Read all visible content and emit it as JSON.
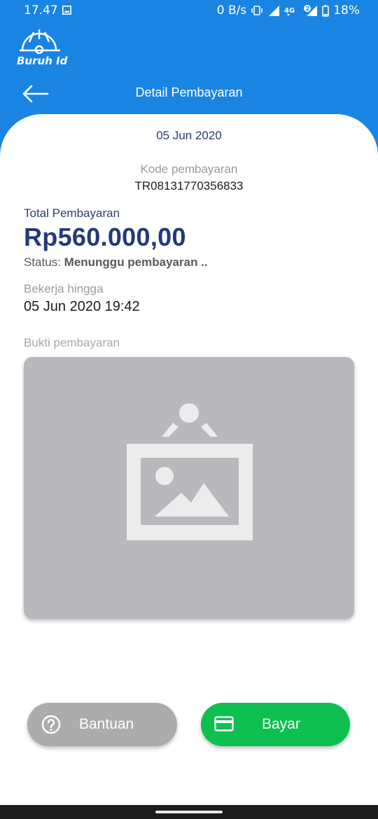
{
  "status_bar": {
    "time": "17.47",
    "net_speed": "0 B/s",
    "battery": "18%",
    "icons": [
      "gallery-icon",
      "vibrate-icon",
      "signal-icon",
      "4g-icon",
      "battery-icon"
    ]
  },
  "app": {
    "logo_text": "Buruh Id",
    "title": "Detail Pembayaran"
  },
  "payment": {
    "date": "05 Jun 2020",
    "code_label": "Kode pembayaran",
    "code_value": "TR08131770356833",
    "total_label": "Total Pembayaran",
    "total_amount": "Rp560.000,00",
    "status_label": "Status:",
    "status_value": "Menunggu pembayaran ..",
    "deadline_label": "Bekerja hingga",
    "deadline_value": "05 Jun 2020 19:42",
    "proof_label": "Bukti pembayaran"
  },
  "actions": {
    "help_label": "Bantuan",
    "pay_label": "Bayar"
  },
  "colors": {
    "primary": "#1a84e3",
    "pay_green": "#0dc04f",
    "help_gray": "#acacad",
    "amount_navy": "#223a7a"
  }
}
